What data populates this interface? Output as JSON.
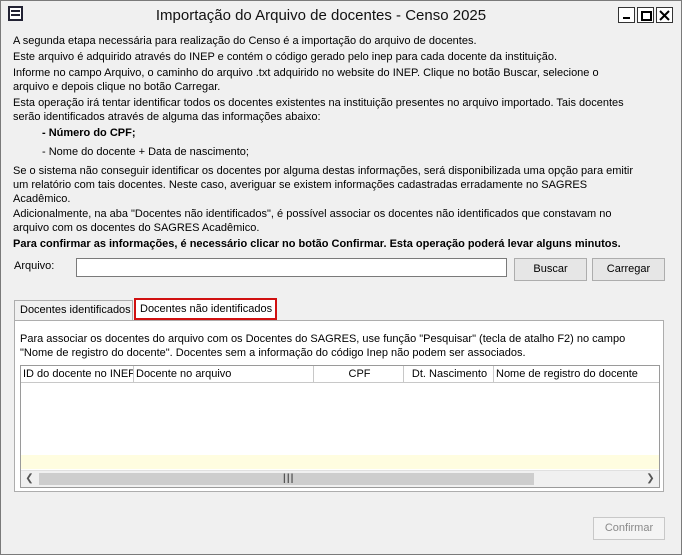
{
  "window": {
    "title": "Importação do Arquivo de docentes - Censo 2025"
  },
  "instructions": {
    "line1": "A segunda etapa necessária para realização do Censo é a importação do arquivo de docentes.",
    "line2": "Este arquivo é adquirido através do INEP e contém o código gerado pelo inep para cada docente da instituição.",
    "line3": "Informe no campo Arquivo, o caminho do arquivo .txt adquirido no website do INEP. Clique no botão Buscar, selecione o",
    "line4": "arquivo e depois clique no botão Carregar.",
    "line5": "Esta operação irá tentar identificar todos os docentes existentes na instituição presentes no arquivo importado. Tais docentes",
    "line6": "serão identificados através de alguma das informações abaixo:",
    "bullet1": "- Número do CPF;",
    "bullet2": "- Nome do docente + Data de nascimento;",
    "line7": "Se o sistema não conseguir identificar os docentes por alguma destas informações, será disponibilizada uma opção para emitir",
    "line8": "um relatório com tais docentes. Neste caso, averiguar se existem informações cadastradas erradamente no SAGRES",
    "line9": "Acadêmico.",
    "line10": "Adicionalmente, na aba \"Docentes não identificados\", é possível associar os docentes não identificados que constavam no",
    "line11": "arquivo com os docentes do SAGRES Acadêmico.",
    "confirm_note": "Para confirmar as informações, é necessário clicar no botão Confirmar. Esta operação poderá levar alguns minutos."
  },
  "file": {
    "label": "Arquivo:",
    "value": "",
    "search_button": "Buscar",
    "load_button": "Carregar"
  },
  "tabs": [
    {
      "label": "Docentes identificados"
    },
    {
      "label": "Docentes não identificados"
    }
  ],
  "panel": {
    "line1": "Para associar os docentes do arquivo com os Docentes do SAGRES, use função \"Pesquisar\" (tecla de atalho F2) no campo",
    "line2": "\"Nome de registro do docente\". Docentes sem a informação do código Inep não podem ser associados."
  },
  "grid": {
    "columns": [
      "ID do docente no INEP",
      "Docente no arquivo",
      "CPF",
      "Dt. Nascimento",
      "Nome de registro do docente"
    ]
  },
  "footer": {
    "confirm_button": "Confirmar"
  }
}
